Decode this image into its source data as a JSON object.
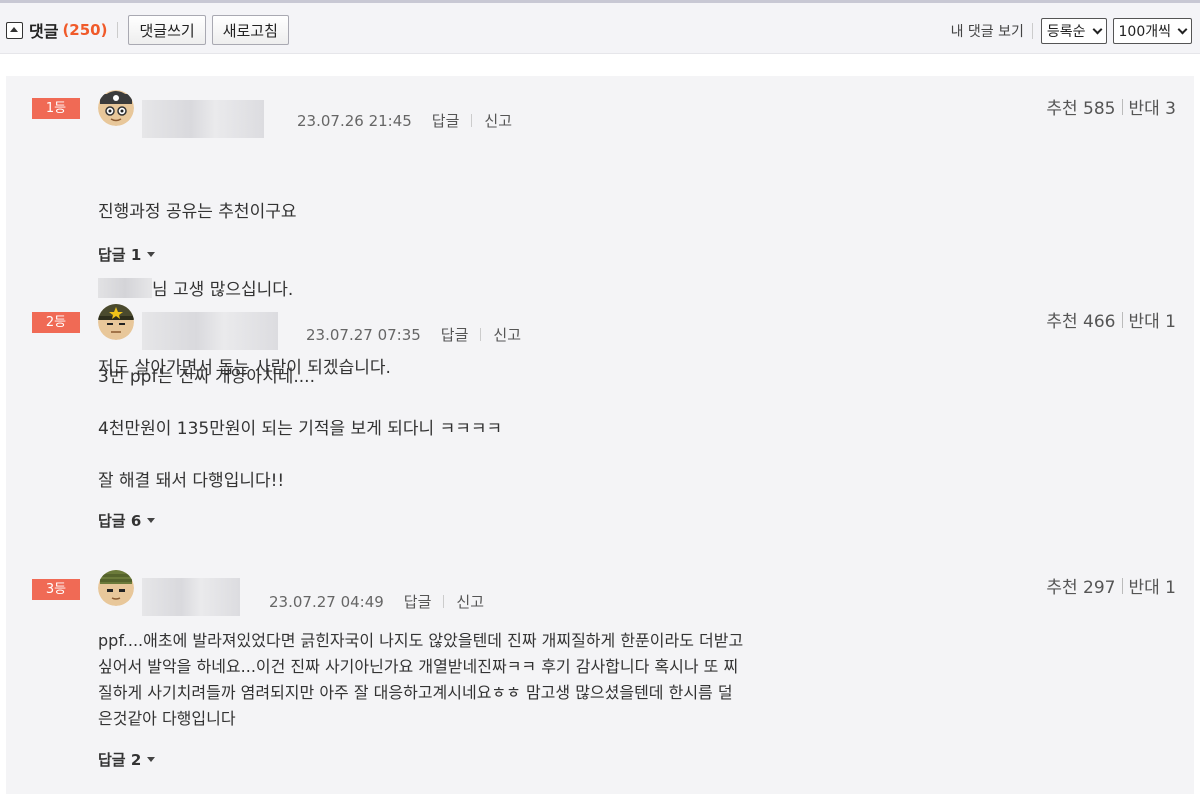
{
  "header": {
    "title": "댓글",
    "count": "(250)",
    "write_label": "댓글쓰기",
    "refresh_label": "새로고침",
    "my_comments_label": "내 댓글 보기",
    "sort_label": "등록순",
    "per_page_label": "100개씩"
  },
  "comments": [
    {
      "rank": "1등",
      "date": "23.07.26 21:45",
      "reply_label": "답글",
      "report_label": "신고",
      "recommend": "추천 585",
      "oppose": "반대 3",
      "line1": "진행과정 공유는 추천이구요",
      "line2": "님 고생 많으십니다.",
      "line3": "저도 살아가면서 돕는 사람이 되겠습니다.",
      "replies": "답글 1"
    },
    {
      "rank": "2등",
      "date": "23.07.27 07:35",
      "reply_label": "답글",
      "report_label": "신고",
      "recommend": "추천 466",
      "oppose": "반대 1",
      "text": "3번 ppf는 진짜 개양아치네....\n\n4천만원이 135만원이 되는 기적을 보게 되다니 ㅋㅋㅋㅋ\n\n잘 해결 돼서 다행입니다!!",
      "replies": "답글 6"
    },
    {
      "rank": "3등",
      "date": "23.07.27 04:49",
      "reply_label": "답글",
      "report_label": "신고",
      "recommend": "추천 297",
      "oppose": "반대 1",
      "text": "ppf....애초에 발라져있었다면 긁힌자국이 나지도 않았을텐데 진짜 개찌질하게 한푼이라도 더받고\n싶어서 발악을 하네요...이건 진짜 사기아닌가요 개열받네진짜ㅋㅋ 후기 감사합니다 혹시나 또 찌\n질하게 사기치려들까 염려되지만 아주 잘 대응하고계시네요ㅎㅎ 맘고생 많으셨을텐데 한시름 덜\n은것같아 다행입니다",
      "replies": "답글 2"
    }
  ]
}
